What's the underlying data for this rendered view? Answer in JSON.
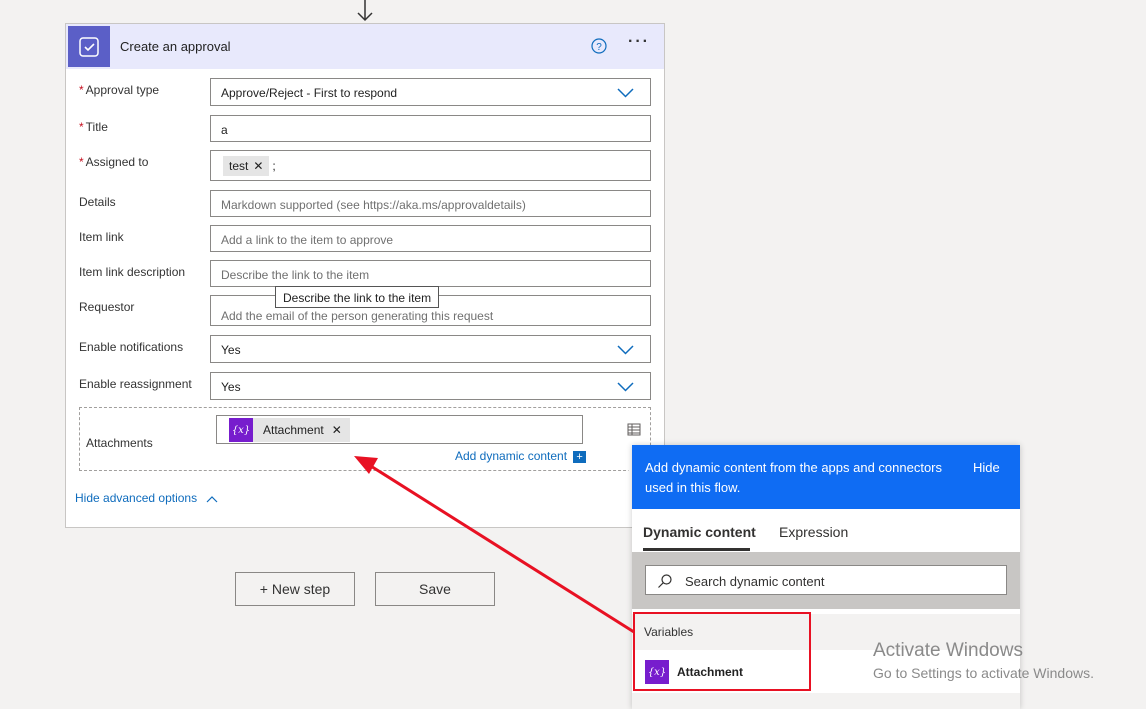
{
  "card": {
    "title": "Create an approval",
    "fields": {
      "approval_type": {
        "label": "Approval type",
        "value": "Approve/Reject - First to respond",
        "required": true
      },
      "title": {
        "label": "Title",
        "value": "a",
        "required": true
      },
      "assigned_to": {
        "label": "Assigned to",
        "token": "test",
        "suffix": ";",
        "required": true
      },
      "details": {
        "label": "Details",
        "placeholder": "Markdown supported (see https://aka.ms/approvaldetails)"
      },
      "item_link": {
        "label": "Item link",
        "placeholder": "Add a link to the item to approve"
      },
      "item_link_description": {
        "label": "Item link description",
        "placeholder": "Describe the link to the item"
      },
      "requestor": {
        "label": "Requestor",
        "placeholder": "Add the email of the person generating this request"
      },
      "enable_notifications": {
        "label": "Enable notifications",
        "value": "Yes"
      },
      "enable_reassignment": {
        "label": "Enable reassignment",
        "value": "Yes"
      },
      "attachments": {
        "label": "Attachments",
        "token": "Attachment",
        "token_icon": "{x}"
      }
    },
    "tooltip": "Describe the link to the item",
    "add_dynamic_label": "Add dynamic content",
    "add_dynamic_plus": "+",
    "hide_advanced_label": "Hide advanced options"
  },
  "buttons": {
    "new_step": "+ New step",
    "save": "Save"
  },
  "dynamic_panel": {
    "header_text": "Add dynamic content from the apps and connectors used in this flow.",
    "hide_label": "Hide",
    "tabs": [
      "Dynamic content",
      "Expression"
    ],
    "active_tab": "Dynamic content",
    "search_placeholder": "Search dynamic content",
    "group_label": "Variables",
    "items": [
      {
        "label": "Attachment",
        "icon": "{x}"
      }
    ]
  },
  "watermark": {
    "line1": "Activate Windows",
    "line2": "Go to Settings to activate Windows."
  },
  "colors": {
    "header_blue": "#0f6cf3",
    "variable_purple": "#771dcd",
    "annotation_red": "#e81123",
    "link_blue": "#0f6cbd"
  }
}
